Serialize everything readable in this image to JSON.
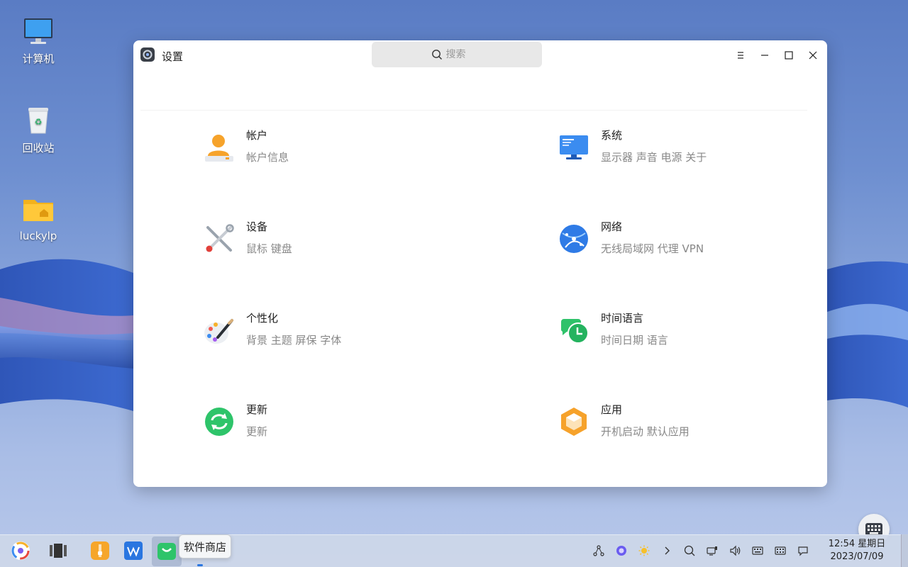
{
  "desktop": {
    "icons": [
      {
        "label": "计算机",
        "icon": "monitor-icon"
      },
      {
        "label": "回收站",
        "icon": "trash-icon"
      },
      {
        "label": "luckylp",
        "icon": "home-folder-icon"
      }
    ]
  },
  "window": {
    "title": "设置",
    "search_placeholder": "搜索",
    "items": [
      {
        "title": "帐户",
        "subtitle": "帐户信息",
        "icon": "user-icon"
      },
      {
        "title": "系统",
        "subtitle": "显示器 声音 电源 关于",
        "icon": "monitor-icon"
      },
      {
        "title": "设备",
        "subtitle": "鼠标 键盘",
        "icon": "tools-icon"
      },
      {
        "title": "网络",
        "subtitle": "无线局域网 代理 VPN",
        "icon": "globe-icon"
      },
      {
        "title": "个性化",
        "subtitle": "背景 主题 屏保 字体",
        "icon": "palette-icon"
      },
      {
        "title": "时间语言",
        "subtitle": "时间日期 语言",
        "icon": "clock-chat-icon"
      },
      {
        "title": "更新",
        "subtitle": "更新",
        "icon": "refresh-icon"
      },
      {
        "title": "应用",
        "subtitle": "开机启动 默认应用",
        "icon": "app-cube-icon"
      }
    ]
  },
  "taskbar": {
    "tooltip": "软件商店",
    "clock_time": "12:54 星期日",
    "clock_date": "2023/07/09"
  },
  "colors": {
    "accent": "#2a76e0",
    "window_bg": "#ffffff",
    "subtitle": "#888888"
  }
}
